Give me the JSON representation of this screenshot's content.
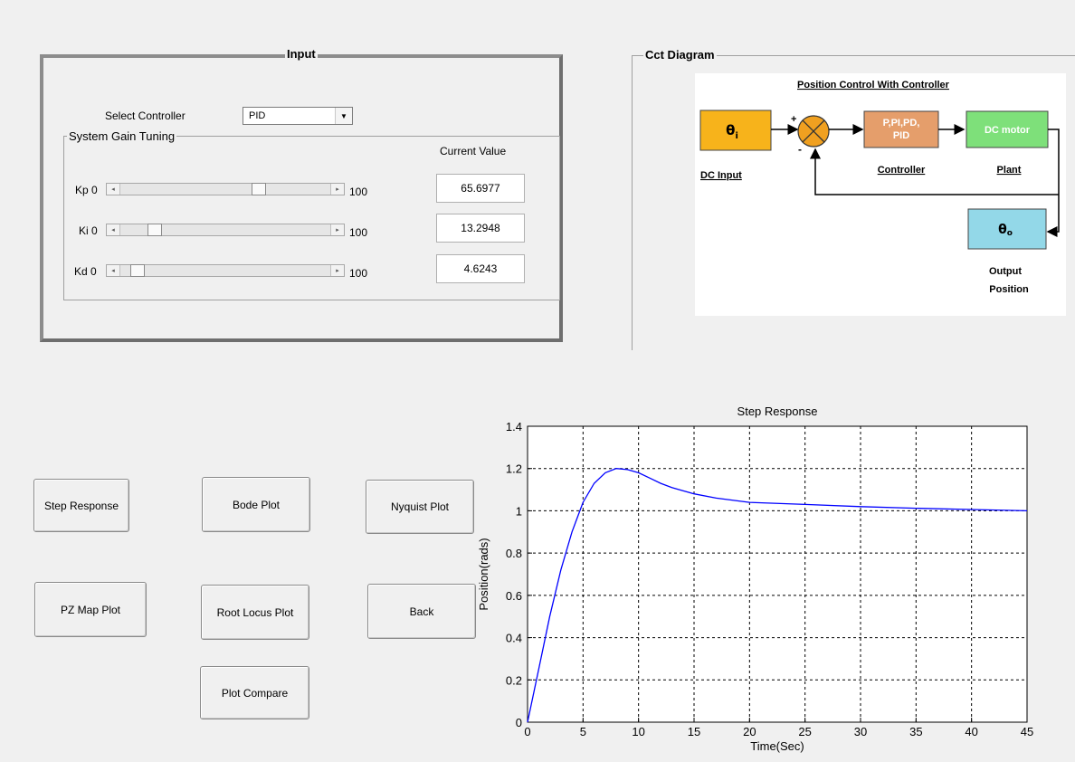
{
  "input_panel": {
    "title": "Input",
    "select_label": "Select Controller",
    "select_value": "PID",
    "gain_group_title": "System Gain Tuning",
    "current_value_header": "Current Value",
    "sliders": [
      {
        "label": "Kp 0",
        "max_label": "100",
        "value": 65.6977,
        "value_text": "65.6977"
      },
      {
        "label": "Ki  0",
        "max_label": "100",
        "value": 13.2948,
        "value_text": "13.2948"
      },
      {
        "label": "Kd  0",
        "max_label": "100",
        "value": 4.6243,
        "value_text": "4.6243"
      }
    ]
  },
  "cct_panel": {
    "title": "Cct Diagram",
    "diagram": {
      "heading": "Position Control With Controller",
      "input_symbol": "θ",
      "input_subscript": "i",
      "sum_plus": "+",
      "sum_minus": "-",
      "controller_block": [
        "P,PI,PD,",
        "PID"
      ],
      "motor_block": "DC motor",
      "output_symbol": "θ",
      "output_subscript": "o",
      "label_input": "DC Input",
      "label_controller": "Controller",
      "label_plant": "Plant",
      "label_output": [
        "Output",
        "Position"
      ],
      "colors": {
        "input": "#f7b31b",
        "controller": "#e59e6b",
        "motor": "#7ee07a",
        "output": "#93d8e8",
        "sum": "#f0a020"
      }
    }
  },
  "buttons": {
    "step_response": "Step Response",
    "bode_plot": "Bode Plot",
    "nyquist_plot": "Nyquist Plot",
    "pz_map_plot": "PZ Map Plot",
    "root_locus_plot": "Root Locus Plot",
    "back": "Back",
    "plot_compare": "Plot Compare"
  },
  "chart_data": {
    "type": "line",
    "title": "Step Response",
    "xlabel": "Time(Sec)",
    "ylabel": "Position(rads)",
    "xlim": [
      0,
      45
    ],
    "ylim": [
      0,
      1.4
    ],
    "xticks": [
      0,
      5,
      10,
      15,
      20,
      25,
      30,
      35,
      40,
      45
    ],
    "yticks": [
      0,
      0.2,
      0.4,
      0.6,
      0.8,
      1,
      1.2,
      1.4
    ],
    "ytick_labels": [
      "0",
      "0.2",
      "0.4",
      "0.6",
      "0.8",
      "1",
      "1.2",
      "1.4"
    ],
    "grid": true,
    "line_color": "#0000ff",
    "series": [
      {
        "x": [
          0,
          1,
          2,
          3,
          4,
          5,
          6,
          7,
          8,
          9,
          10,
          11,
          12,
          13,
          14,
          15,
          17,
          20,
          25,
          30,
          35,
          40,
          45
        ],
        "y": [
          0,
          0.25,
          0.5,
          0.72,
          0.9,
          1.04,
          1.13,
          1.18,
          1.2,
          1.195,
          1.18,
          1.155,
          1.13,
          1.11,
          1.095,
          1.08,
          1.06,
          1.04,
          1.03,
          1.02,
          1.012,
          1.006,
          1.0
        ]
      }
    ]
  }
}
